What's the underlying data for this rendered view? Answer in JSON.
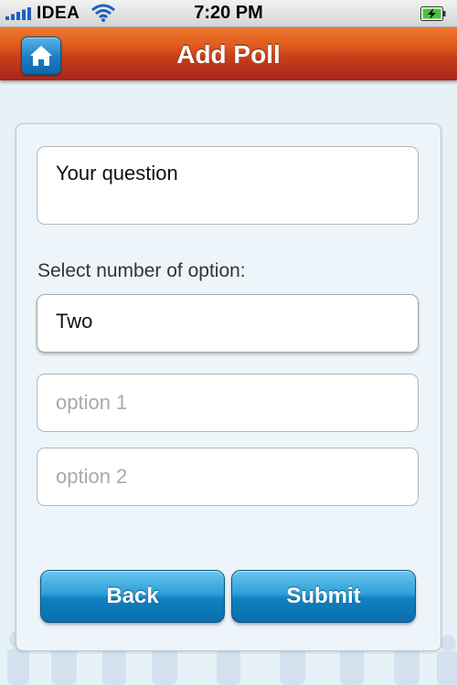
{
  "status_bar": {
    "carrier": "IDEA",
    "time": "7:20 PM",
    "signal_icon": "signal-bars-icon",
    "wifi_icon": "wifi-icon",
    "battery_icon": "battery-charging-icon"
  },
  "header": {
    "title": "Add Poll",
    "home_icon": "home-icon",
    "colors": {
      "bar_top": "#ed7a2f",
      "bar_bottom": "#a8251a",
      "home_button": "#1d7cc2"
    }
  },
  "form": {
    "question": {
      "placeholder": "Your question"
    },
    "select_label": "Select number of option:",
    "select_value": "Two",
    "options": [
      {
        "placeholder": "option 1"
      },
      {
        "placeholder": "option 2"
      }
    ],
    "buttons": {
      "back": "Back",
      "submit": "Submit"
    },
    "colors": {
      "button": "#1f8fcc",
      "placeholder": "#a9a9a9"
    }
  }
}
